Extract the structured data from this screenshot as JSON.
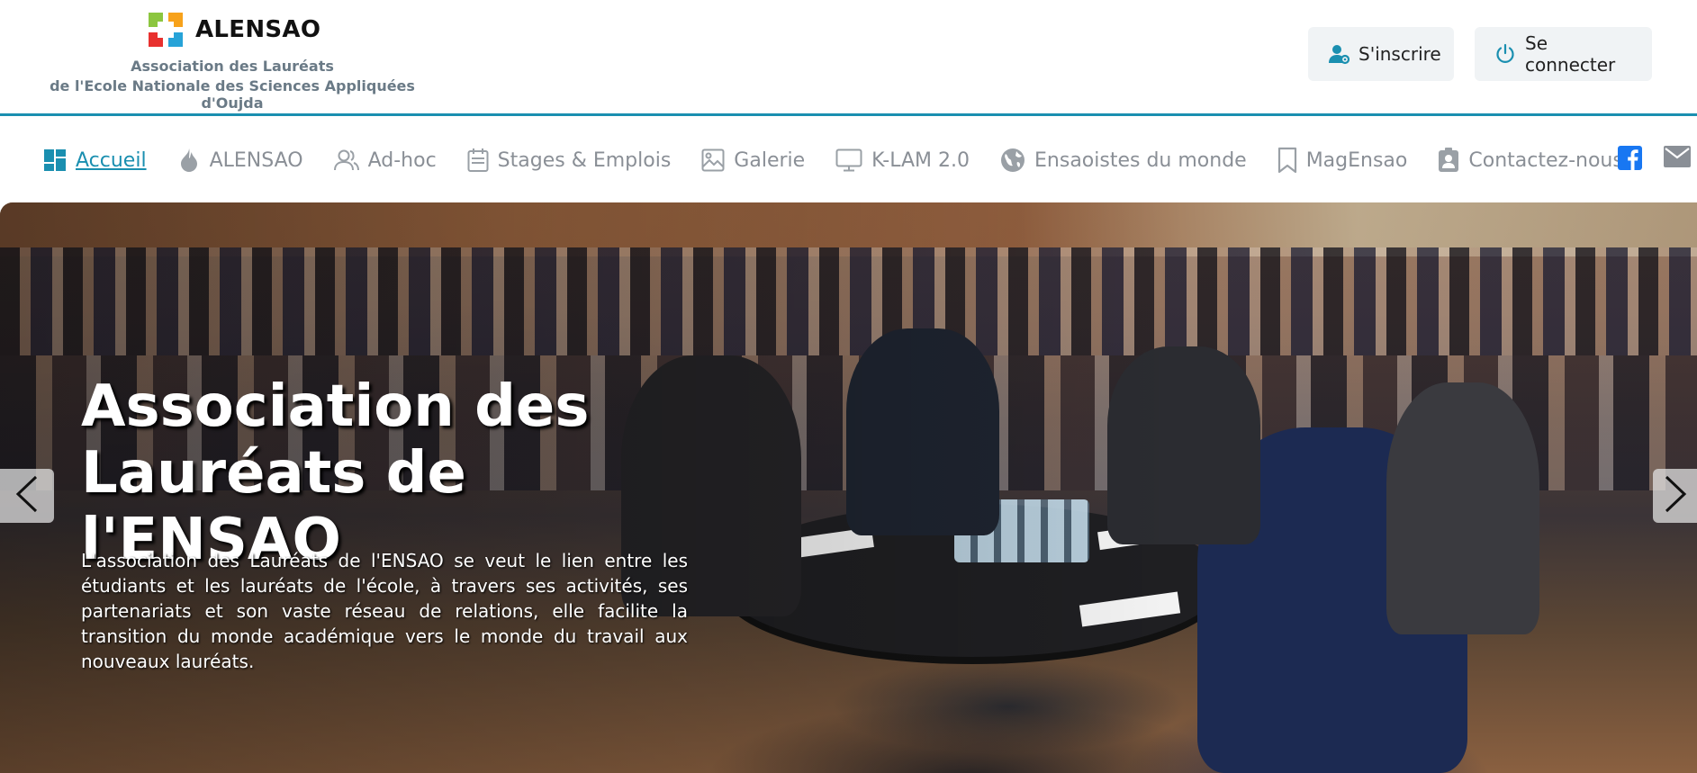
{
  "header": {
    "logo_name": "ALENSAO",
    "logo_sub1": "Association des Lauréats",
    "logo_sub2": "de l'Ecole Nationale des Sciences Appliquées d'Oujda",
    "register_label": "S'inscrire",
    "login_label": "Se connecter",
    "accent_color": "#1a8fb0"
  },
  "nav": {
    "items": [
      {
        "label": "Accueil",
        "icon": "dashboard-icon",
        "active": true
      },
      {
        "label": "ALENSAO",
        "icon": "flame-icon"
      },
      {
        "label": "Ad-hoc",
        "icon": "users-icon"
      },
      {
        "label": "Stages & Emplois",
        "icon": "calendar-icon"
      },
      {
        "label": "Galerie",
        "icon": "image-icon"
      },
      {
        "label": "K-LAM 2.0",
        "icon": "monitor-icon"
      },
      {
        "label": "Ensaoistes du monde",
        "icon": "globe-icon"
      },
      {
        "label": "MagEnsao",
        "icon": "bookmark-icon"
      },
      {
        "label": "Contactez-nous",
        "icon": "contact-badge-icon"
      }
    ],
    "social": [
      {
        "name": "facebook-icon",
        "color": "#1877f2"
      },
      {
        "name": "mail-icon",
        "color": "#8a8f96"
      }
    ]
  },
  "hero": {
    "title": "Association des Lauréats de l'ENSAO",
    "text": "L'association des Lauréats de l'ENSAO se veut le lien entre les étudiants et les lauréats de l'école, à travers ses activités, ses partenariats et son vaste réseau de relations, elle facilite la transition du monde académique vers le monde du travail aux nouveaux lauréats."
  }
}
